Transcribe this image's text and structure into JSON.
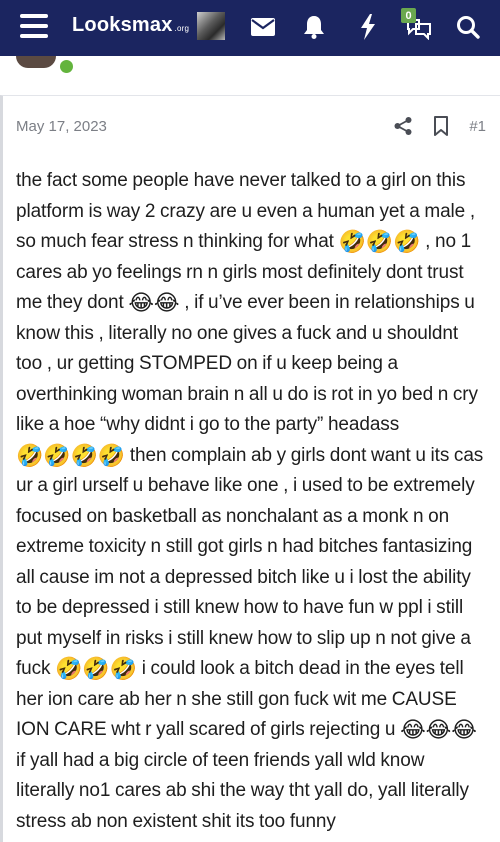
{
  "site": {
    "logo_text": "Looksmax",
    "logo_tld": ".org",
    "conversations_badge": "0"
  },
  "icons": {
    "menu": "hamburger-menu-icon",
    "avatar": "user-avatar",
    "inbox": "envelope-icon",
    "alerts": "bell-icon",
    "whats_new": "lightning-bolt-icon",
    "conversations": "speech-bubbles-icon",
    "search": "magnifier-icon",
    "share": "share-icon",
    "bookmark": "bookmark-icon"
  },
  "colors": {
    "navbar": "#1b2560",
    "online": "#63b43d",
    "badge": "#6aa84f",
    "meta_text": "#7c7f86"
  },
  "post": {
    "date": "May 17, 2023",
    "number": "#1",
    "body_segments": [
      "the fact some people have never talked to a girl on this platform is way 2 crazy are u even a human yet a male , so much fear stress n thinking for what ",
      "🤣🤣🤣",
      " , no 1 cares ab yo feelings rn n girls most definitely dont trust me they dont ",
      "😂😂",
      " , if u’ve ever been in relationships u know this , literally no one gives a fuck and u shouldnt too , ur getting STOMPED on if u keep being a overthinking woman brain n all u do is rot in yo bed n cry like a hoe “why didnt i go to the party” headass ",
      "🤣🤣🤣🤣",
      " then complain ab y girls dont want u its cas ur a girl urself u behave like one , i used to be extremely focused on basketball as nonchalant as a monk n on extreme toxicity n still got girls n had bitches fantasizing all cause im not a depressed bitch like u i lost the ability to be depressed i still knew how to have fun w ppl i still put myself in risks i still knew how to slip up n not give a fuck ",
      "🤣🤣🤣",
      " i could look a bitch dead in the eyes tell her ion care ab her n she still gon fuck wit me CAUSE ION CARE wht r yall scared of girls rejecting u ",
      "😂😂😂",
      " if yall had a big circle of teen friends yall wld know literally no1 cares ab shi the way tht yall do, yall literally stress ab non existent shit its too funny"
    ]
  }
}
